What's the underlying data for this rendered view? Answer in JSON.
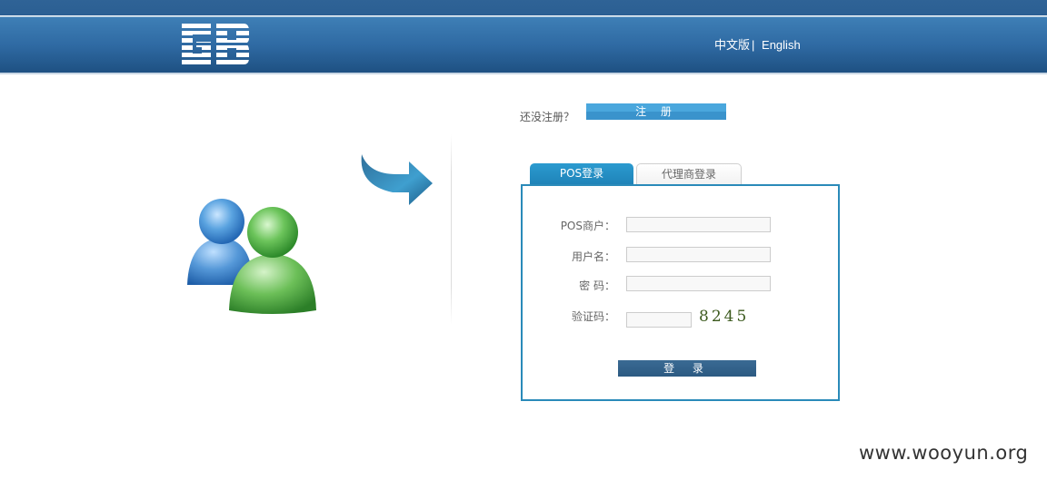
{
  "header": {
    "logo_text": "GB",
    "lang_chinese": "中文版",
    "lang_separator": "|",
    "lang_english": "English"
  },
  "register": {
    "prompt": "还没注册？",
    "button_label": "注 册"
  },
  "tabs": [
    {
      "label": "POS登录",
      "active": true
    },
    {
      "label": "代理商登录",
      "active": false
    }
  ],
  "form": {
    "merchant_label": "POS商户：",
    "merchant_value": "",
    "username_label": "用户名：",
    "username_value": "",
    "password_label": "密 码：",
    "password_value": "",
    "captcha_label": "验证码：",
    "captcha_value": "",
    "captcha_image_text": "8245",
    "login_button": "登 录"
  },
  "watermark": "www.wooyun.org",
  "colors": {
    "header_blue": "#2f6aa3",
    "accent_blue": "#2a8ab9",
    "register_blue": "#4aa7dd",
    "login_button": "#2c5a82"
  },
  "icons": [
    "logo-gb-icon",
    "users-icon",
    "arrow-icon"
  ]
}
